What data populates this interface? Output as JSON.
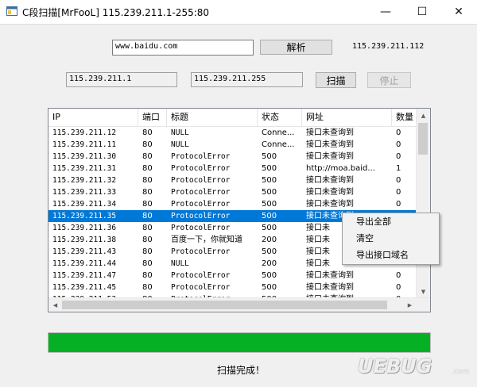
{
  "window": {
    "title": "C段扫描[MrFooL] 115.239.211.1-255:80",
    "minimize_glyph": "—",
    "maximize_glyph": "☐",
    "close_glyph": "✕",
    "icon": "app-window-icon"
  },
  "domain_input": {
    "value": "www.baidu.com"
  },
  "resolve_button": {
    "label": "解析"
  },
  "resolved_ip": "115.239.211.112",
  "start_ip": {
    "value": "115.239.211.1"
  },
  "end_ip": {
    "value": "115.239.211.255"
  },
  "scan_button": {
    "label": "扫描"
  },
  "stop_button": {
    "label": "停止"
  },
  "table": {
    "columns": [
      "IP",
      "端口",
      "标题",
      "状态",
      "网址",
      "数量"
    ],
    "rows": [
      [
        "115.239.211.12",
        "80",
        "NULL",
        "Conne...",
        "接口未查询到",
        "0"
      ],
      [
        "115.239.211.11",
        "80",
        "NULL",
        "Conne...",
        "接口未查询到",
        "0"
      ],
      [
        "115.239.211.30",
        "80",
        "ProtocolError",
        "500",
        "接口未查询到",
        "0"
      ],
      [
        "115.239.211.31",
        "80",
        "ProtocolError",
        "500",
        "http://moa.baid...",
        "1"
      ],
      [
        "115.239.211.32",
        "80",
        "ProtocolError",
        "500",
        "接口未查询到",
        "0"
      ],
      [
        "115.239.211.33",
        "80",
        "ProtocolError",
        "500",
        "接口未查询到",
        "0"
      ],
      [
        "115.239.211.34",
        "80",
        "ProtocolError",
        "500",
        "接口未查询到",
        "0"
      ],
      [
        "115.239.211.35",
        "80",
        "ProtocolError",
        "500",
        "接口未查询到",
        "0"
      ],
      [
        "115.239.211.36",
        "80",
        "ProtocolError",
        "500",
        "接口未",
        ""
      ],
      [
        "115.239.211.38",
        "80",
        "百度一下，你就知道",
        "200",
        "接口未",
        ""
      ],
      [
        "115.239.211.43",
        "80",
        "ProtocolError",
        "500",
        "接口未",
        ""
      ],
      [
        "115.239.211.44",
        "80",
        "NULL",
        "200",
        "接口未",
        ""
      ],
      [
        "115.239.211.47",
        "80",
        "ProtocolError",
        "500",
        "接口未查询到",
        "0"
      ],
      [
        "115.239.211.45",
        "80",
        "ProtocolError",
        "500",
        "接口未查询到",
        "0"
      ],
      [
        "115.239.211.53",
        "80",
        "ProtocolError",
        "500",
        "接口未查询到",
        "0"
      ]
    ],
    "selected_row": 7
  },
  "context_menu": {
    "items": [
      "导出全部",
      "清空",
      "导出接口域名"
    ]
  },
  "progress": {
    "fraction": 1.0,
    "color": "#06b025"
  },
  "status_text": "扫描完成！",
  "watermark": {
    "text": "UEBUG",
    "sub": ".com"
  },
  "colors": {
    "selection": "#0078d7",
    "progress": "#06b025"
  }
}
